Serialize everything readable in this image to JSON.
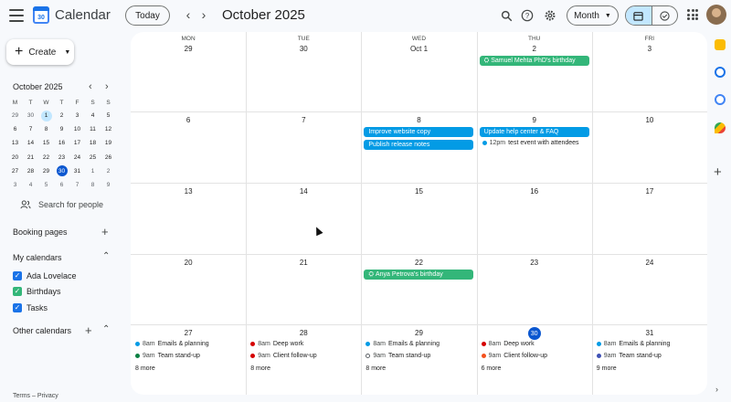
{
  "header": {
    "app_title": "Calendar",
    "logo_text": "30",
    "today_label": "Today",
    "month_title": "October 2025",
    "view_label": "Month"
  },
  "sidebar": {
    "create_label": "Create",
    "mini_cal": {
      "title": "October 2025",
      "dow": [
        "M",
        "T",
        "W",
        "T",
        "F",
        "S",
        "S"
      ],
      "weeks": [
        [
          "29",
          "30",
          "1",
          "2",
          "3",
          "4",
          "5"
        ],
        [
          "6",
          "7",
          "8",
          "9",
          "10",
          "11",
          "12"
        ],
        [
          "13",
          "14",
          "15",
          "16",
          "17",
          "18",
          "19"
        ],
        [
          "20",
          "21",
          "22",
          "23",
          "24",
          "25",
          "26"
        ],
        [
          "27",
          "28",
          "29",
          "30",
          "31",
          "1",
          "2"
        ],
        [
          "3",
          "4",
          "5",
          "6",
          "7",
          "8",
          "9"
        ]
      ],
      "selected_day": "1",
      "current_day": "30"
    },
    "search_people": "Search for people",
    "booking_pages": "Booking pages",
    "my_calendars": "My calendars",
    "calendars": [
      {
        "name": "Ada Lovelace",
        "color": "#1a73e8"
      },
      {
        "name": "Birthdays",
        "color": "#33b679"
      },
      {
        "name": "Tasks",
        "color": "#1a73e8"
      }
    ],
    "other_calendars": "Other calendars",
    "footer": "Terms – Privacy"
  },
  "grid": {
    "dow": [
      "MON",
      "TUE",
      "WED",
      "THU",
      "FRI"
    ],
    "weeks": [
      [
        "29",
        "30",
        "Oct 1",
        "2",
        "3"
      ],
      [
        "6",
        "7",
        "8",
        "9",
        "10"
      ],
      [
        "13",
        "14",
        "15",
        "16",
        "17"
      ],
      [
        "20",
        "21",
        "22",
        "23",
        "24"
      ],
      [
        "27",
        "28",
        "29",
        "30",
        "31"
      ]
    ],
    "today": "30"
  },
  "events": {
    "samuel_birthday": "Samuel Mehta PhD's birthday",
    "improve_website": "Improve website copy",
    "publish_notes": "Publish release notes",
    "update_help": "Update help center & FAQ",
    "test_event_time": "12pm",
    "test_event": "test event with attendees",
    "anya_birthday": "Anya Petrova's birthday",
    "last_week": [
      {
        "items": [
          {
            "time": "8am",
            "title": "Emails & planning",
            "color": "#039be5"
          },
          {
            "time": "9am",
            "title": "Team stand-up",
            "color": "#0b8043"
          }
        ],
        "more": "8 more"
      },
      {
        "items": [
          {
            "time": "8am",
            "title": "Deep work",
            "color": "#d50000"
          },
          {
            "time": "9am",
            "title": "Client follow-up",
            "color": "#d50000"
          }
        ],
        "more": "8 more"
      },
      {
        "items": [
          {
            "time": "8am",
            "title": "Emails & planning",
            "color": "#039be5"
          },
          {
            "time": "9am",
            "title": "Team stand-up",
            "color": "hollow"
          }
        ],
        "more": "8 more"
      },
      {
        "items": [
          {
            "time": "8am",
            "title": "Deep work",
            "color": "#d50000"
          },
          {
            "time": "9am",
            "title": "Client follow-up",
            "color": "#f4511e"
          }
        ],
        "more": "6 more"
      },
      {
        "items": [
          {
            "time": "8am",
            "title": "Emails & planning",
            "color": "#039be5"
          },
          {
            "time": "9am",
            "title": "Team stand-up",
            "color": "#3f51b5"
          }
        ],
        "more": "9 more"
      }
    ]
  },
  "colors": {
    "birthday_green": "#33b679",
    "task_blue": "#039be5",
    "today_blue": "#0b57d0"
  }
}
